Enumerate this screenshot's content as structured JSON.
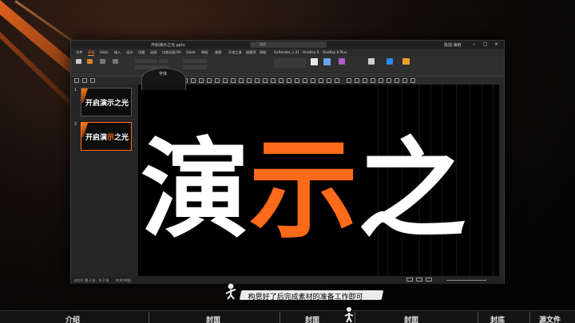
{
  "window": {
    "title": "开启演示之光.pptx",
    "search_placeholder": "搜索",
    "user": "陈前·海晗"
  },
  "ribbon_tabs": [
    "文件",
    "开始",
    "Slide",
    "插入",
    "设计",
    "切换",
    "动画",
    "口袋动画 PA",
    "iSlide",
    "审阅",
    "视图",
    "开发工具",
    "加载项",
    "帮助",
    "AirRender_1.21",
    "OneKey 8",
    "OneKey 8 Plus"
  ],
  "ribbon_active": "开始",
  "font_tooltip": "字体",
  "thumbnails": [
    {
      "num": "1",
      "text_a": "开启演示之光",
      "text_b": ""
    },
    {
      "num": "2",
      "text_a": "开启演示",
      "accent": "示",
      "text_c": "之光"
    }
  ],
  "slide": {
    "char1": "演",
    "char2": "示",
    "char3": "之"
  },
  "statusbar": {
    "left": "幻灯片 第 2 张，共 2 张",
    "lang": "中文(中国)"
  },
  "subtitle": "构思好了后完成素材的准备工作即可",
  "bottom_nav": [
    "介绍",
    "封面",
    "封面",
    "封面",
    "封底",
    "源文件"
  ],
  "colors": {
    "accent": "#ff6a1a",
    "active_tab": "#ff8a3d"
  }
}
